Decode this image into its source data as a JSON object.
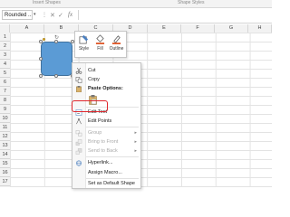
{
  "ribbon": {
    "left_label": "Insert Shapes",
    "right_label": "Shape Styles"
  },
  "formula_bar": {
    "name_box": "Rounded ...",
    "dots": "⋮",
    "cancel": "✕",
    "enter": "✓",
    "fx": "fx",
    "value": ""
  },
  "grid": {
    "columns": [
      "A",
      "B",
      "C",
      "D",
      "E",
      "F",
      "G",
      "H"
    ],
    "rows": [
      "1",
      "2",
      "3",
      "4",
      "5",
      "6",
      "7",
      "8",
      "9",
      "10",
      "11",
      "12",
      "13",
      "14",
      "15",
      "16",
      "17"
    ]
  },
  "mini_toolbar": {
    "style_label": "Style",
    "fill_label": "Fill",
    "outline_label": "Outline",
    "accent_fill": "#e05a2b",
    "accent_outline": "#e05a2b"
  },
  "context_menu": {
    "cut": "Cut",
    "copy": "Copy",
    "paste_options": "Paste Options:",
    "edit_text": "Edit Text",
    "edit_points": "Edit Points",
    "group": "Group",
    "bring_to_front": "Bring to Front",
    "send_to_back": "Send to Back",
    "hyperlink": "Hyperlink...",
    "assign_macro": "Assign Macro...",
    "set_default": "Set as Default Shape"
  },
  "colors": {
    "shape_fill": "#5b9bd5",
    "highlight": "#e0262d"
  }
}
